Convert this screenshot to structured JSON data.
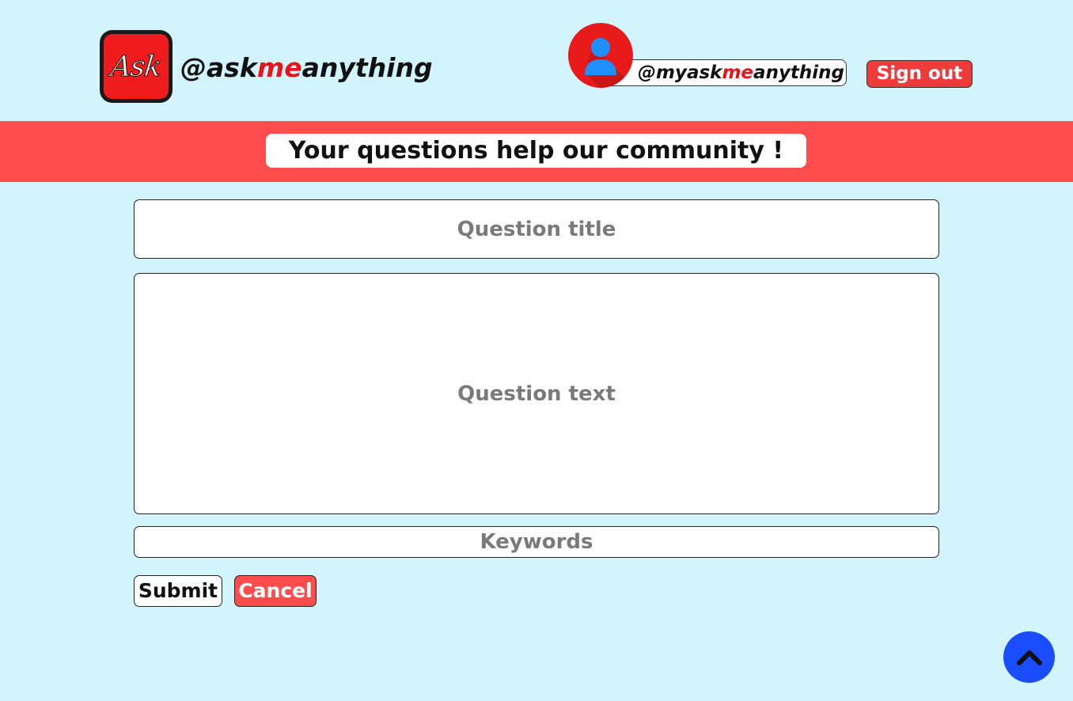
{
  "header": {
    "logo_text": "Ask",
    "brand": {
      "prefix": "@ask",
      "highlight": "me",
      "suffix": "anything"
    },
    "user": {
      "prefix": "@myask",
      "highlight": "me",
      "suffix": "anything"
    },
    "signout_label": "Sign out"
  },
  "banner": {
    "text": "Your questions help our community !"
  },
  "form": {
    "title_placeholder": "Question title",
    "text_placeholder": "Question text",
    "keywords_placeholder": "Keywords",
    "submit_label": "Submit",
    "cancel_label": "Cancel"
  },
  "icons": {
    "avatar": "user-avatar-icon",
    "scroll_top": "chevron-up-icon"
  },
  "colors": {
    "background": "#d2f4fd",
    "accent_red": "#ff4d4d",
    "brand_red": "#e8141a",
    "scroll_blue": "#1a4dff",
    "avatar_blue": "#1e90ff"
  }
}
